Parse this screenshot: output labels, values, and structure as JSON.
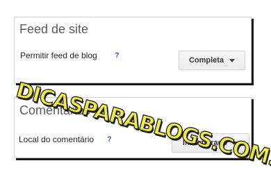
{
  "feed_panel": {
    "title": "Feed de site",
    "row_label": "Permitir feed de blog",
    "help": "?",
    "dropdown_value": "Completa",
    "dropdown_icon": "chevron-down-icon"
  },
  "comments_panel": {
    "title": "Comentários",
    "row_label": "Local do comentário",
    "help": "?",
    "dropdown_value": "Incorporado",
    "dropdown_icon": "chevron-down-icon"
  },
  "watermark": {
    "text": "DICASPARABLOGS.COM.BR",
    "fill_color": "#f2ea3a",
    "outline_color": "#111111"
  },
  "colors": {
    "help_link": "#2a5db0",
    "title_text": "#5a5a5a"
  }
}
